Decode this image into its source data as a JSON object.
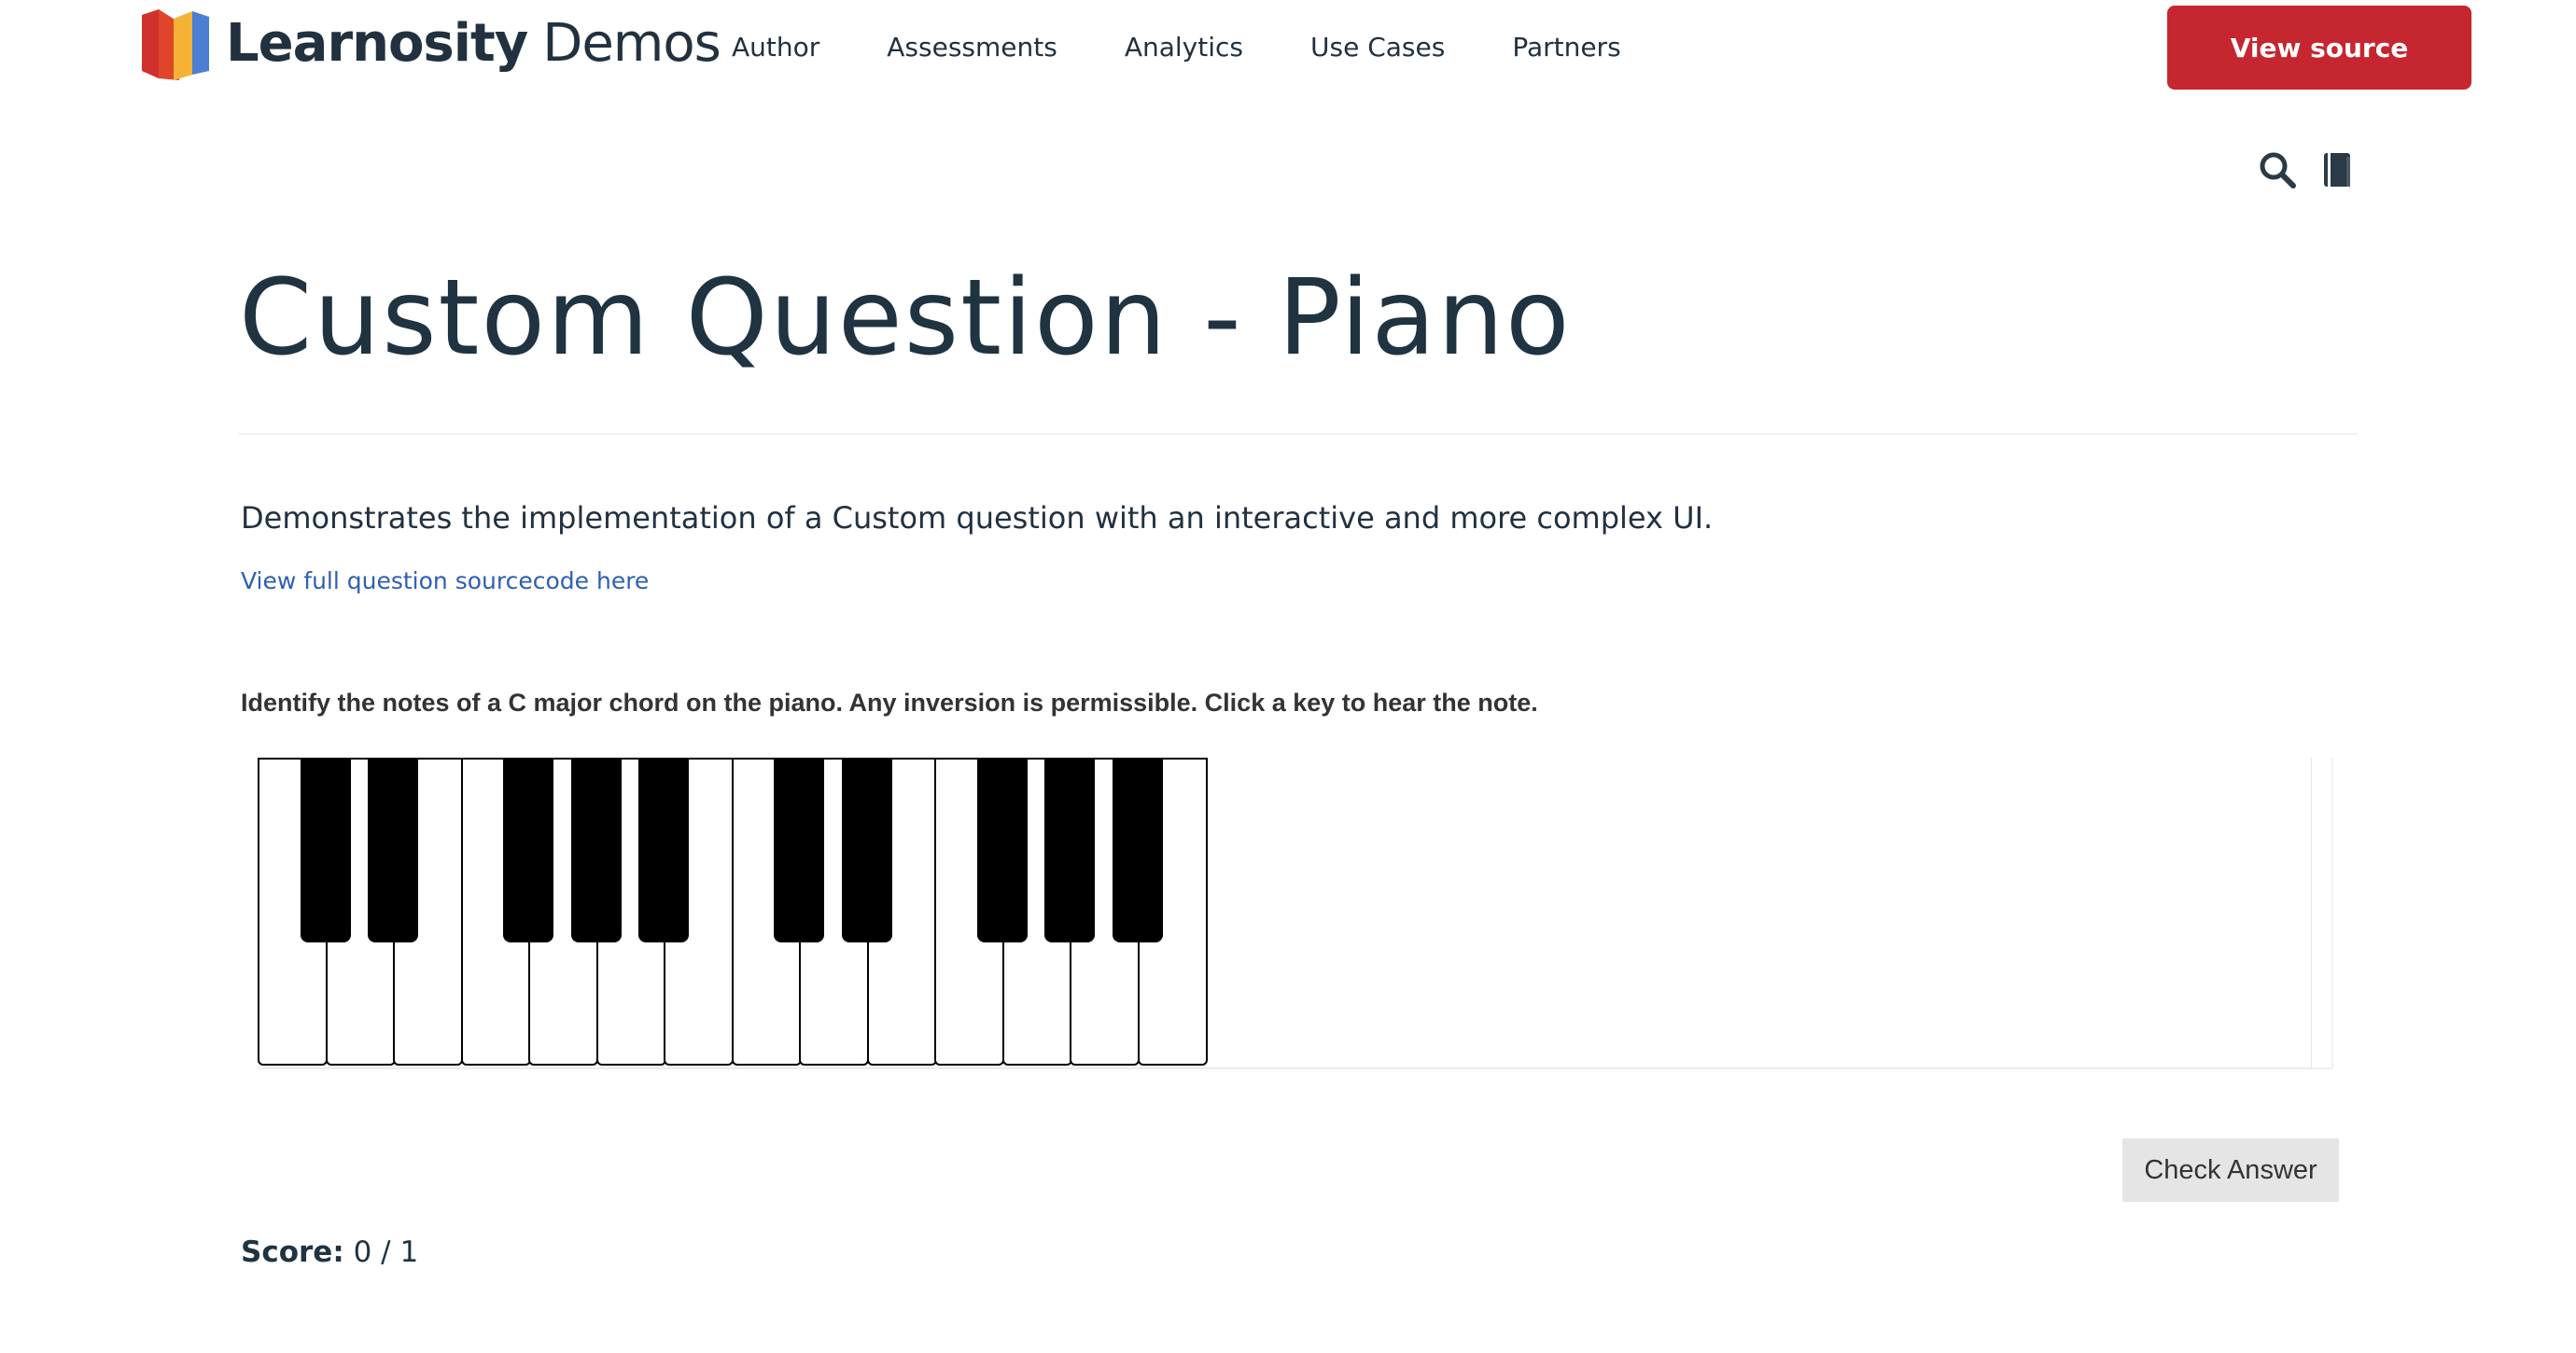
{
  "header": {
    "logo": {
      "brand": "Learnosity",
      "suffix": "Demos",
      "colors": [
        "#d0312d",
        "#f5b335",
        "#4a7fd4"
      ]
    },
    "nav": [
      {
        "label": "Author"
      },
      {
        "label": "Assessments"
      },
      {
        "label": "Analytics"
      },
      {
        "label": "Use Cases"
      },
      {
        "label": "Partners"
      }
    ],
    "view_source_label": "View source",
    "accent_color": "#c5262f",
    "icons": [
      "search-icon",
      "book-icon"
    ]
  },
  "main": {
    "title": "Custom Question - Piano",
    "description": "Demonstrates the implementation of a Custom question with an interactive and more complex UI.",
    "source_link": "View full question sourcecode here",
    "instructions": "Identify the notes of a C major chord on the piano. Any inversion is permissible. Click a key to hear the note.",
    "piano": {
      "white_keys": [
        "C",
        "D",
        "E",
        "F",
        "G",
        "A",
        "B",
        "C",
        "D",
        "E",
        "F",
        "G",
        "A",
        "B"
      ],
      "black_keys": [
        "C#",
        "D#",
        "F#",
        "G#",
        "A#",
        "C#",
        "D#",
        "F#",
        "G#",
        "A#"
      ]
    },
    "check_answer_label": "Check Answer",
    "score": {
      "label": "Score:",
      "value": "0 / 1"
    }
  }
}
